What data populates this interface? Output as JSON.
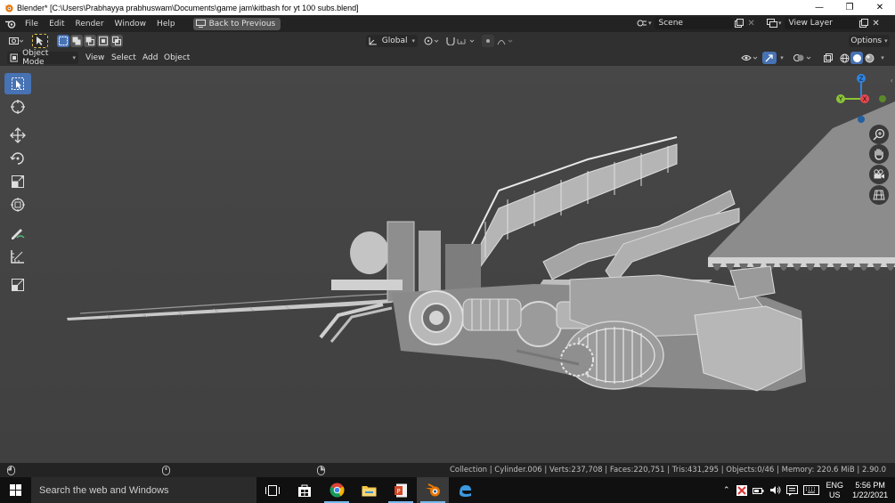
{
  "window": {
    "title": "Blender* [C:\\Users\\Prabhayya prabhuswam\\Documents\\game jam\\kitbash for yt 100 subs.blend]"
  },
  "menubar": {
    "items": [
      "File",
      "Edit",
      "Render",
      "Window",
      "Help"
    ],
    "back_label": "Back to Previous",
    "scene_name": "Scene",
    "view_layer": "View Layer"
  },
  "tool_header": {
    "orientation": "Global",
    "options_label": "Options"
  },
  "viewport_header": {
    "mode": "Object Mode",
    "menus": [
      "View",
      "Select",
      "Add",
      "Object"
    ]
  },
  "gizmo": {
    "x_label": "X",
    "y_label": "Y",
    "z_label": "Z",
    "colors": {
      "x": "#e8464e",
      "y": "#8bc33a",
      "z": "#2f84e3"
    }
  },
  "statusbar": {
    "text": "Collection | Cylinder.006 | Verts:237,708 | Faces:220,751 | Tris:431,295 | Objects:0/46 | Memory: 220.6 MiB | 2.90.0"
  },
  "taskbar": {
    "search_placeholder": "Search the web and Windows",
    "lang": "ENG",
    "region": "US",
    "time": "5:56 PM",
    "date": "1/22/2021"
  },
  "colors": {
    "accent": "#4772b3",
    "viewport_bg": "#434343",
    "header_bg": "#303030"
  }
}
